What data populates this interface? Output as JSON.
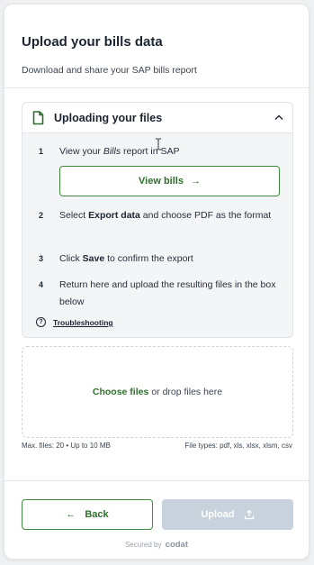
{
  "header": {
    "title": "Upload your bills data",
    "subtitle": "Download and share your SAP bills report"
  },
  "panel": {
    "title": "Uploading your files",
    "steps": [
      {
        "num": "1",
        "pre": "View your ",
        "em": "Bills",
        "post": " report in SAP"
      },
      {
        "num": "2",
        "pre": "Select ",
        "strong": "Export data",
        "post": " and choose PDF as the format"
      },
      {
        "num": "3",
        "pre": "Click ",
        "strong": "Save",
        "post": " to confirm the export"
      },
      {
        "num": "4",
        "text": "Return here and upload the resulting files in the box below"
      }
    ],
    "view_bills_label": "View bills",
    "troubleshooting": "Troubleshooting"
  },
  "dropzone": {
    "choose_label": "Choose files",
    "drop_text": "or drop files here",
    "max_files": "Max. files: 20 • Up to 10 MB",
    "file_types": "File types: pdf, xls, xlsx, xlsm, csv"
  },
  "footer": {
    "back_label": "Back",
    "upload_label": "Upload",
    "secured_by": "Secured by",
    "brand": "codat"
  },
  "colors": {
    "accent_green": "#2f6f2c",
    "disabled_button": "#c7d2dd"
  }
}
